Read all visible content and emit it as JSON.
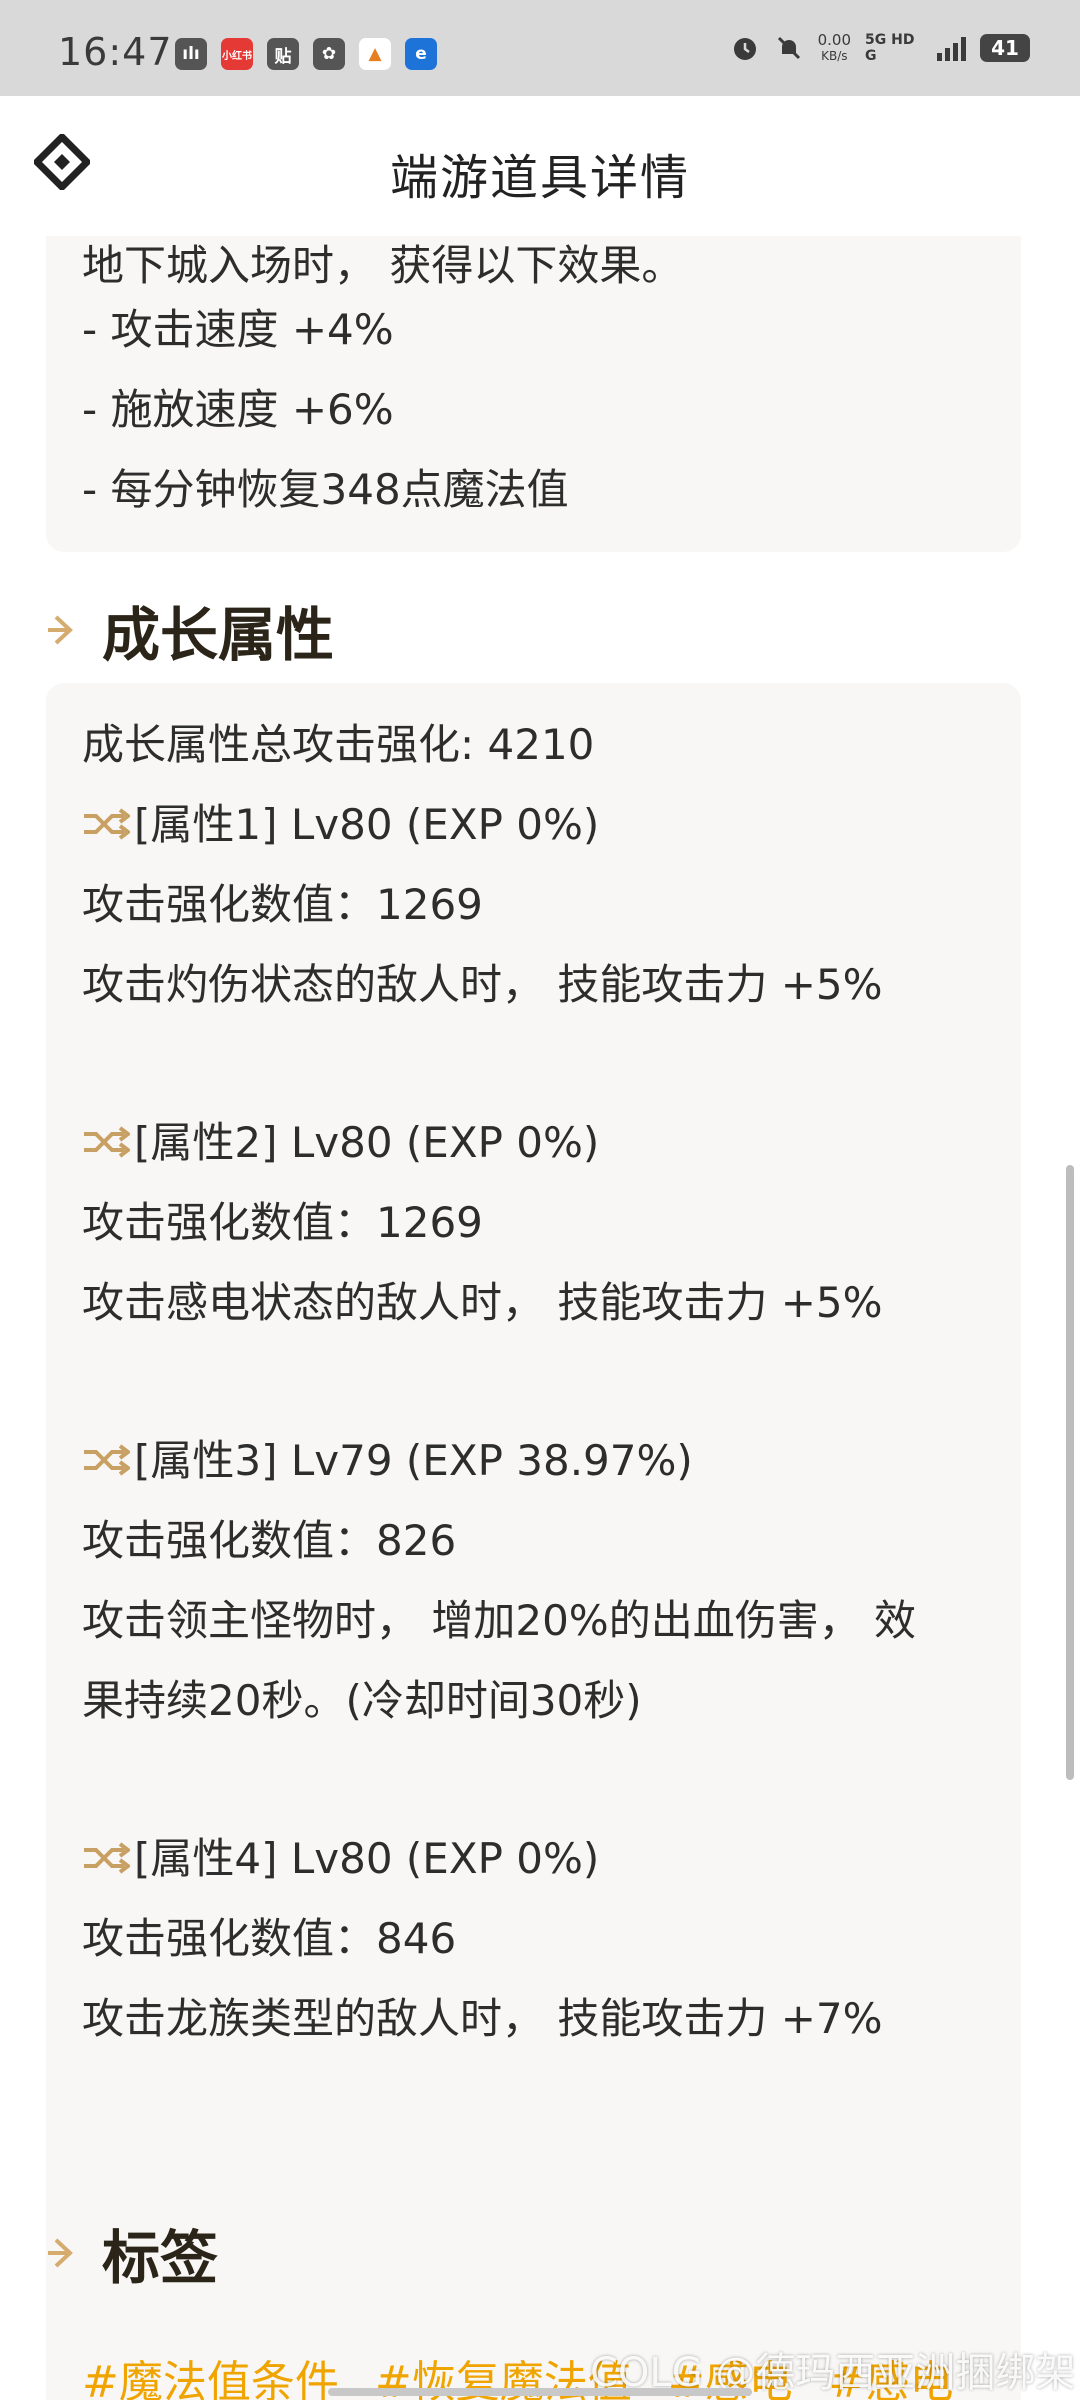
{
  "status_bar": {
    "time": "16:47",
    "apps": [
      "ılı",
      "小红书",
      "贴",
      "✿",
      "▲",
      "e"
    ],
    "net_speed": "0.00",
    "net_unit": "KB/s",
    "network": "5G HD G",
    "battery": "41"
  },
  "header": {
    "title": "端游道具详情",
    "logo_icon": "diamond-logo-icon"
  },
  "effect_card": {
    "lines": [
      "地下城入场时， 获得以下效果。",
      "- 攻击速度 +4%",
      "- 施放速度 +6%",
      "- 每分钟恢复348点魔法值"
    ]
  },
  "growth": {
    "title": "成长属性",
    "total": "成长属性总攻击强化: 4210",
    "attrs": [
      {
        "head": "[属性1] Lv80 (EXP 0%)",
        "value": "攻击强化数值：1269",
        "desc": [
          "攻击灼伤状态的敌人时， 技能攻击力 +5%"
        ]
      },
      {
        "head": "[属性2] Lv80 (EXP 0%)",
        "value": "攻击强化数值：1269",
        "desc": [
          "攻击感电状态的敌人时， 技能攻击力 +5%"
        ]
      },
      {
        "head": "[属性3] Lv79 (EXP 38.97%)",
        "value": "攻击强化数值：826",
        "desc": [
          "攻击领主怪物时， 增加20%的出血伤害， 效",
          "果持续20秒。(冷却时间30秒)"
        ]
      },
      {
        "head": "[属性4] Lv80 (EXP 0%)",
        "value": "攻击强化数值：846",
        "desc": [
          "攻击龙族类型的敌人时， 技能攻击力 +7%"
        ]
      }
    ]
  },
  "tags": {
    "title": "标签",
    "items": [
      "#魔法值条件",
      "#恢复魔法值",
      "#感电",
      "#感电"
    ]
  },
  "watermark": "COLG @德玛西亚洲捆绑架",
  "colors": {
    "accent": "#c9a063",
    "tag": "#f0a400",
    "card": "#f8f7f5"
  }
}
